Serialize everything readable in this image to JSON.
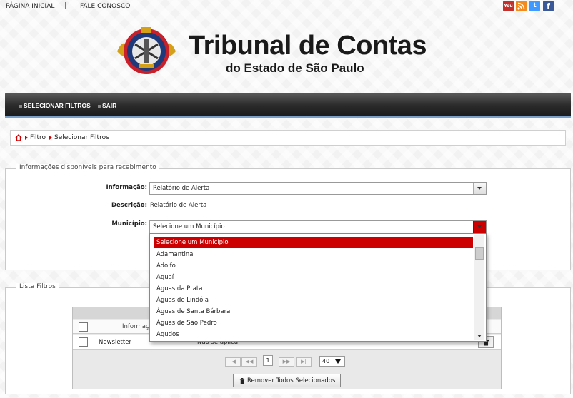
{
  "top_links": {
    "home": "PÁGINA INICIAL",
    "separator": "|",
    "contact": "FALE CONOSCO"
  },
  "social": [
    {
      "name": "youtube-icon",
      "label": "You",
      "color": "#c4302b"
    },
    {
      "name": "rss-icon",
      "label": "",
      "color": "#f28a1d"
    },
    {
      "name": "twitter-icon",
      "label": "t",
      "color": "#4099ff"
    },
    {
      "name": "facebook-icon",
      "label": "f",
      "color": "#3b5998"
    }
  ],
  "header": {
    "title": "Tribunal de Contas",
    "subtitle": "do Estado de São Paulo"
  },
  "menu": {
    "filters": "SELECIONAR FILTROS",
    "logout": "SAIR"
  },
  "breadcrumb": {
    "level1": "Filtro",
    "level2": "Selecionar Filtros"
  },
  "form": {
    "legend": "Informações disponíveis para recebimento",
    "info_label": "Informação:",
    "info_value": "Relatório de Alerta",
    "desc_label": "Descrição:",
    "desc_value": "Relatório de Alerta",
    "muni_label": "Município:",
    "muni_value": "Selecione um Município"
  },
  "dropdown": {
    "options": [
      "Selecione um Município",
      "Adamantina",
      "Adolfo",
      "Aguaí",
      "Águas da Prata",
      "Águas de Lindóia",
      "Águas de Santa Bárbara",
      "Águas de São Pedro",
      "Agudos"
    ],
    "selected_index": 0
  },
  "list": {
    "legend": "Lista Filtros",
    "col_info": "Informação",
    "rows": [
      {
        "info": "Newsletter",
        "value": "Não se aplica"
      }
    ],
    "page": "1",
    "page_size": "40",
    "remove_all": "Remover Todos Selecionados"
  },
  "colors": {
    "accent": "#cc0000",
    "menu_bar": "#2a2a2a",
    "menu_border": "#7a9fc8"
  }
}
